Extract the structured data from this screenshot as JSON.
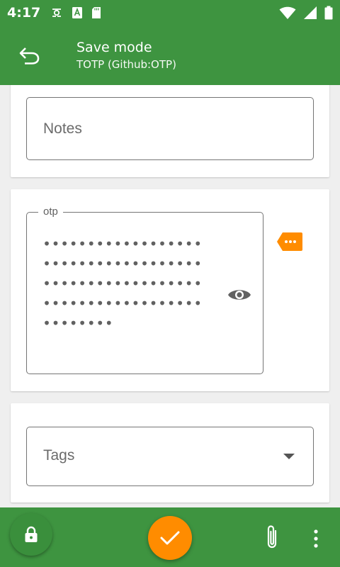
{
  "status_bar": {
    "time": "4:17",
    "left_icons": [
      "accessibility-icon",
      "font-icon",
      "sd-card-icon"
    ],
    "right_icons": [
      "wifi-icon",
      "signal-icon",
      "battery-icon"
    ]
  },
  "app_bar": {
    "title": "Save mode",
    "subtitle": "TOTP (Github:OTP)",
    "color": "#3e9440"
  },
  "notes_field": {
    "placeholder": "Notes"
  },
  "otp_field": {
    "label": "otp",
    "masked_value": "••••••••••••••••••••••••••••••••••••••••••••••••••••••••••••••••••••••••••••••••",
    "reveal_icon": "eye-icon",
    "tag_icon": "tag-more-icon",
    "tag_color": "#ff8c00"
  },
  "tags_field": {
    "placeholder": "Tags"
  },
  "bottom_bar": {
    "lock_icon": "lock-icon",
    "save_icon": "check-icon",
    "attach_icon": "paperclip-icon",
    "more_icon": "more-vert-icon",
    "accent": "#ff8c00"
  }
}
